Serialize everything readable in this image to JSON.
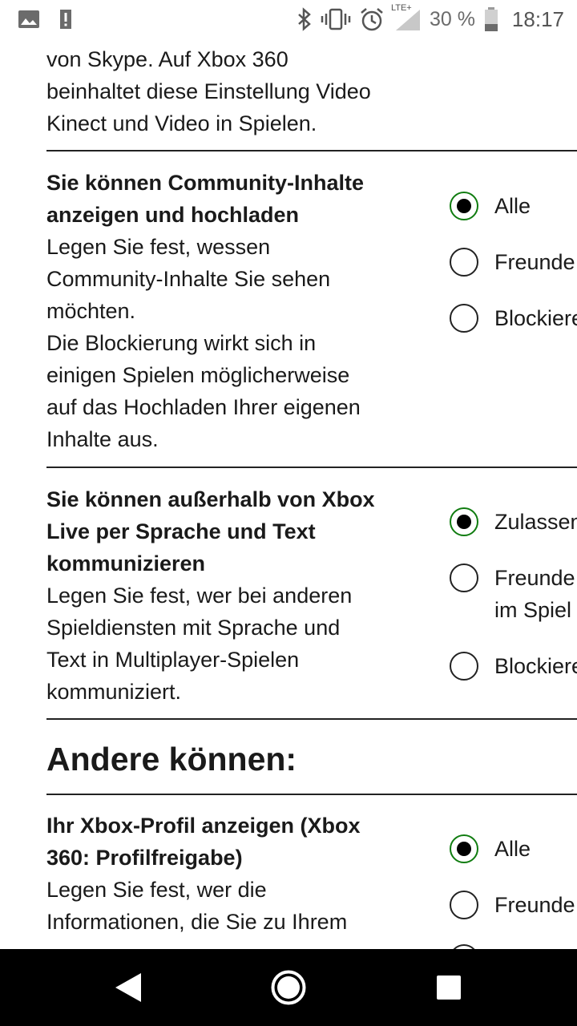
{
  "status_bar": {
    "lte_label": "LTE+",
    "battery_percent": "30 %",
    "time": "18:17",
    "icons": [
      "image-icon",
      "alert-icon",
      "bluetooth-icon",
      "vibrate-icon",
      "alarm-icon",
      "signal-icon",
      "battery-icon"
    ]
  },
  "intro": {
    "lines": [
      "von Skype. Auf Xbox 360",
      "beinhaltet diese Einstellung Video",
      "Kinect und Video in Spielen."
    ]
  },
  "settings": [
    {
      "title_lines": [
        "Sie können Community-Inhalte",
        "anzeigen und hochladen"
      ],
      "desc_lines": [
        "Legen Sie fest, wessen",
        "Community-Inhalte Sie sehen",
        "möchten.",
        "Die Blockierung wirkt sich in",
        "einigen Spielen möglicherweise",
        "auf das Hochladen Ihrer eigenen",
        "Inhalte aus."
      ],
      "options": [
        {
          "label": "Alle",
          "checked": true
        },
        {
          "label": "Freunde",
          "checked": false
        },
        {
          "label": "Blockieren",
          "checked": false
        }
      ]
    },
    {
      "title_lines": [
        "Sie können außerhalb von Xbox",
        "Live per Sprache und Text",
        "kommunizieren"
      ],
      "desc_lines": [
        "Legen Sie fest, wer bei anderen",
        "Spieldiensten mit Sprache und",
        "Text in Multiplayer-Spielen",
        "kommuniziert."
      ],
      "options": [
        {
          "label": "Zulassen",
          "checked": true
        },
        {
          "label": "Freunde",
          "label2": "im Spiel",
          "checked": false
        },
        {
          "label": "Blockieren",
          "checked": false
        }
      ]
    }
  ],
  "section": {
    "title": "Andere können:"
  },
  "profile_setting": {
    "title_lines": [
      "Ihr Xbox-Profil anzeigen (Xbox",
      "360: Profilfreigabe)"
    ],
    "desc_lines": [
      "Legen Sie fest, wer die",
      "Informationen, die Sie zu Ihrem"
    ],
    "options": [
      {
        "label": "Alle",
        "checked": true
      },
      {
        "label": "Freunde",
        "checked": false
      }
    ]
  },
  "nav": {
    "back": "back-icon",
    "home": "home-icon",
    "recents": "recents-icon"
  }
}
